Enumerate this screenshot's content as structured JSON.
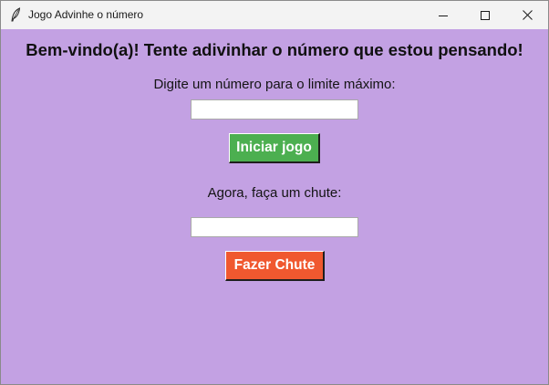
{
  "window": {
    "title": "Jogo Advinhe o número",
    "icon": "feather-icon",
    "controls": {
      "minimize_icon": "minimize-icon",
      "maximize_icon": "maximize-icon",
      "close_icon": "close-icon"
    },
    "background_color": "#c3a1e3"
  },
  "main": {
    "heading": "Bem-vindo(a)! Tente adivinhar o número que estou pensando!",
    "max_limit": {
      "label": "Digite um número para o limite máximo:",
      "value": ""
    },
    "start_button": {
      "label": "Iniciar jogo",
      "color": "#4caf50"
    },
    "guess": {
      "label": "Agora, faça um chute:",
      "value": ""
    },
    "guess_button": {
      "label": "Fazer Chute",
      "color": "#f0582f"
    }
  }
}
